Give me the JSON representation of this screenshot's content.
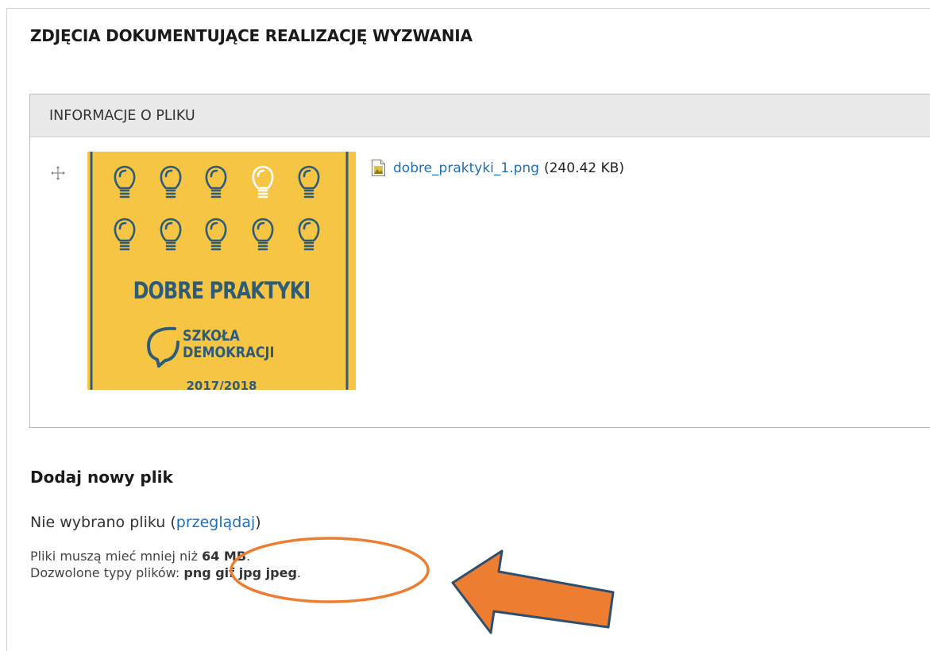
{
  "field": {
    "title": "ZDJĘCIA DOKUMENTUJĄCE REALIZACJĘ WYZWANIA"
  },
  "table": {
    "header": "INFORMACJE O PLIKU",
    "file": {
      "name": "dobre_praktyki_1.png",
      "size": "(240.42 KB)",
      "thumbnail": {
        "title": "DOBRE PRAKTYKI",
        "logo_line1": "SZKOŁA",
        "logo_line2": "DEMOKRACJI",
        "years": "2017/2018",
        "background_color": "#f6c544",
        "accent_color": "#2e5b78"
      }
    }
  },
  "upload": {
    "title": "Dodaj nowy plik",
    "status_prefix": "Nie wybrano pliku (",
    "browse_label": "przeglądaj",
    "status_suffix": ")",
    "size_prefix": "Pliki muszą mieć mniej niż ",
    "size_limit": "64 MB",
    "size_suffix": ".",
    "types_prefix": "Dozwolone typy plików: ",
    "types": "png gif jpg jpeg",
    "types_suffix": "."
  },
  "annotation": {
    "color": "#ed7d31"
  },
  "icons": {
    "drag": "move-arrows-icon",
    "file": "image-file-icon"
  }
}
